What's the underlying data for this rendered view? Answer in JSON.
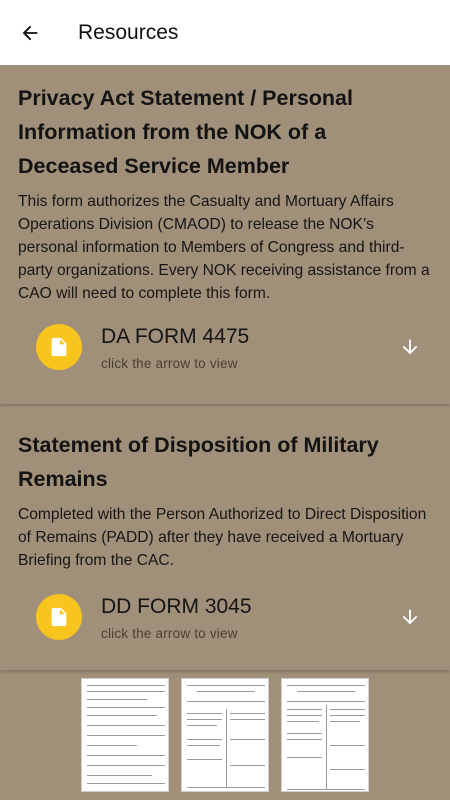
{
  "appbar": {
    "title": "Resources",
    "back_icon": "arrow-left-icon"
  },
  "resources": [
    {
      "title": "Privacy Act Statement / Personal Information from the NOK of a Deceased Service Member",
      "description": "This form authorizes the Casualty and Mortuary Affairs Operations Division (CMAOD) to release the NOK’s personal information to Members of Congress and third-party organizations. Every NOK receiving assistance from a CAO will need to complete this form.",
      "form_name": "DA FORM 4475",
      "hint": "click the arrow to view",
      "icon": "document-icon",
      "action_icon": "download-arrow-icon"
    },
    {
      "title": "Statement of Disposition of Military Remains",
      "description": "Completed with the Person Authorized to Direct Disposition of Remains (PADD) after they have received a Mortuary Briefing from the CAC.",
      "form_name": "DD FORM 3045",
      "hint": "click the arrow to view",
      "icon": "document-icon",
      "action_icon": "download-arrow-icon"
    }
  ],
  "colors": {
    "background": "#a08f79",
    "icon_circle": "#f7c51e",
    "appbar": "#ffffff"
  }
}
